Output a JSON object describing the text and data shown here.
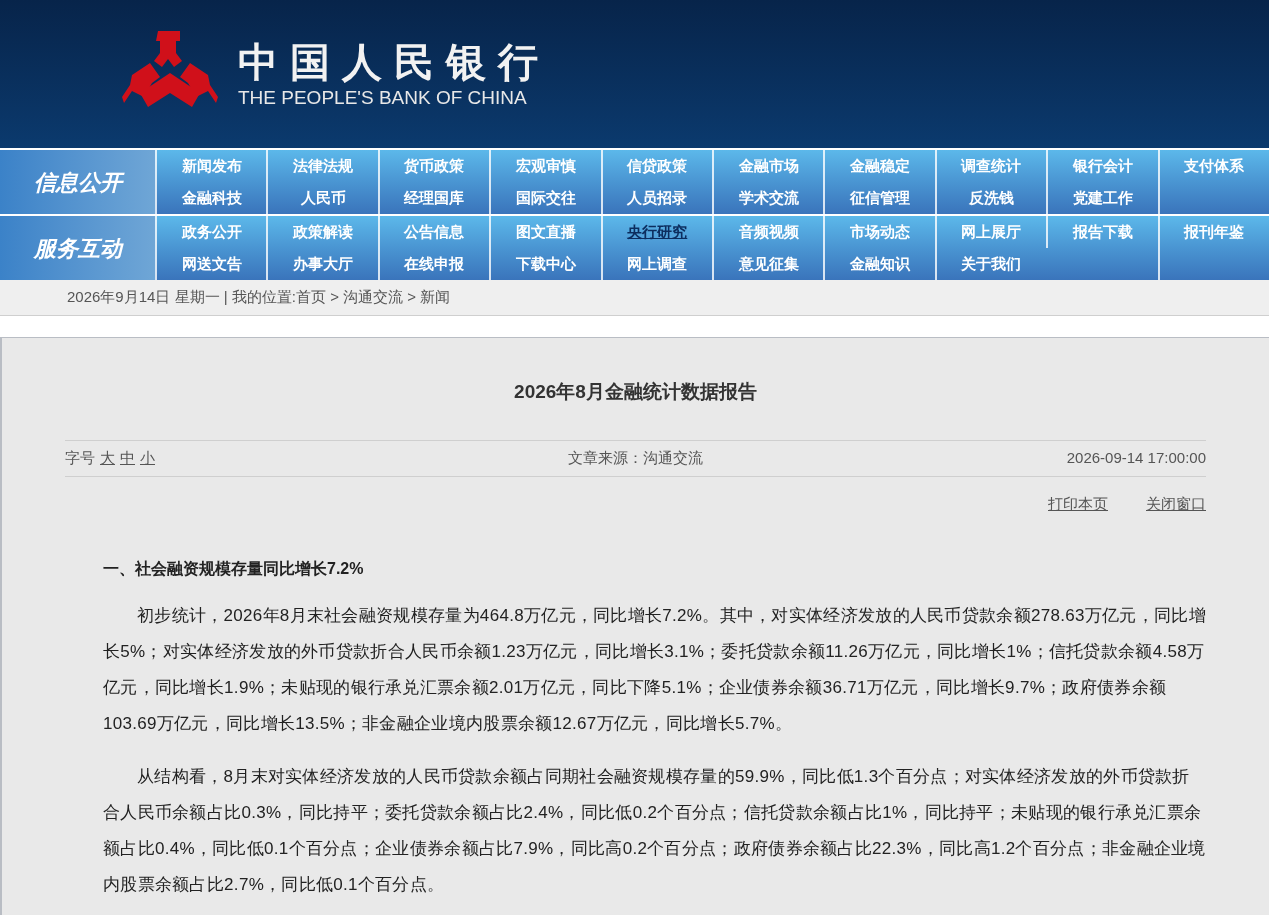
{
  "header": {
    "logo_cn": "中国人民银行",
    "logo_en": "THE PEOPLE'S BANK OF CHINA"
  },
  "nav": [
    {
      "label": "信息公开",
      "rows": [
        [
          {
            "label": "新闻发布",
            "selected": false
          },
          {
            "label": "法律法规",
            "selected": false
          },
          {
            "label": "货币政策",
            "selected": false
          },
          {
            "label": "宏观审慎",
            "selected": false
          },
          {
            "label": "信贷政策",
            "selected": false
          },
          {
            "label": "金融市场",
            "selected": false
          },
          {
            "label": "金融稳定",
            "selected": false
          },
          {
            "label": "调查统计",
            "selected": false
          },
          {
            "label": "银行会计",
            "selected": false
          },
          {
            "label": "支付体系",
            "selected": false
          }
        ],
        [
          {
            "label": "金融科技",
            "selected": false
          },
          {
            "label": "人民币",
            "selected": false
          },
          {
            "label": "经理国库",
            "selected": false
          },
          {
            "label": "国际交往",
            "selected": false
          },
          {
            "label": "人员招录",
            "selected": false
          },
          {
            "label": "学术交流",
            "selected": false
          },
          {
            "label": "征信管理",
            "selected": false
          },
          {
            "label": "反洗钱",
            "selected": false
          },
          {
            "label": "党建工作",
            "selected": false
          }
        ]
      ]
    },
    {
      "label": "服务互动",
      "rows": [
        [
          {
            "label": "政务公开",
            "selected": false
          },
          {
            "label": "政策解读",
            "selected": false
          },
          {
            "label": "公告信息",
            "selected": false
          },
          {
            "label": "图文直播",
            "selected": false
          },
          {
            "label": "央行研究",
            "selected": true
          },
          {
            "label": "音频视频",
            "selected": false
          },
          {
            "label": "市场动态",
            "selected": false
          },
          {
            "label": "网上展厅",
            "selected": false
          },
          {
            "label": "报告下载",
            "selected": false
          },
          {
            "label": "报刊年鉴",
            "selected": false
          }
        ],
        [
          {
            "label": "网送文告",
            "selected": false
          },
          {
            "label": "办事大厅",
            "selected": false
          },
          {
            "label": "在线申报",
            "selected": false
          },
          {
            "label": "下载中心",
            "selected": false
          },
          {
            "label": "网上调查",
            "selected": false
          },
          {
            "label": "意见征集",
            "selected": false
          },
          {
            "label": "金融知识",
            "selected": false
          },
          {
            "label": "关于我们",
            "selected": false
          }
        ]
      ]
    }
  ],
  "breadcrumb": "2026年9月14日 星期一 | 我的位置:首页 > 沟通交流 > 新闻",
  "article": {
    "title": "2026年8月金融统计数据报告",
    "font_size_label": "字号",
    "font_sizes": [
      "大",
      "中",
      "小"
    ],
    "source": "文章来源：沟通交流",
    "datetime": "2026-09-14 17:00:00",
    "actions": [
      "打印本页",
      "关闭窗口"
    ],
    "heading": "一、社会融资规模存量同比增长7.2%",
    "paragraphs": [
      "初步统计，2026年8月末社会融资规模存量为464.8万亿元，同比增长7.2%。其中，对实体经济发放的人民币贷款余额278.63万亿元，同比增长5%；对实体经济发放的外币贷款折合人民币余额1.23万亿元，同比增长3.1%；委托贷款余额11.26万亿元，同比增长1%；信托贷款余额4.58万亿元，同比增长1.9%；未贴现的银行承兑汇票余额2.01万亿元，同比下降5.1%；企业债券余额36.71万亿元，同比增长9.7%；政府债券余额103.69万亿元，同比增长13.5%；非金融企业境内股票余额12.67万亿元，同比增长5.7%。",
      "从结构看，8月末对实体经济发放的人民币贷款余额占同期社会融资规模存量的59.9%，同比低1.3个百分点；对实体经济发放的外币贷款折合人民币余额占比0.3%，同比持平；委托贷款余额占比2.4%，同比低0.2个百分点；信托贷款余额占比1%，同比持平；未贴现的银行承兑汇票余额占比0.4%，同比低0.1个百分点；企业债券余额占比7.9%，同比高0.2个百分点；政府债券余额占比22.3%，同比高1.2个百分点；非金融企业境内股票余额占比2.7%，同比低0.1个百分点。"
    ]
  }
}
